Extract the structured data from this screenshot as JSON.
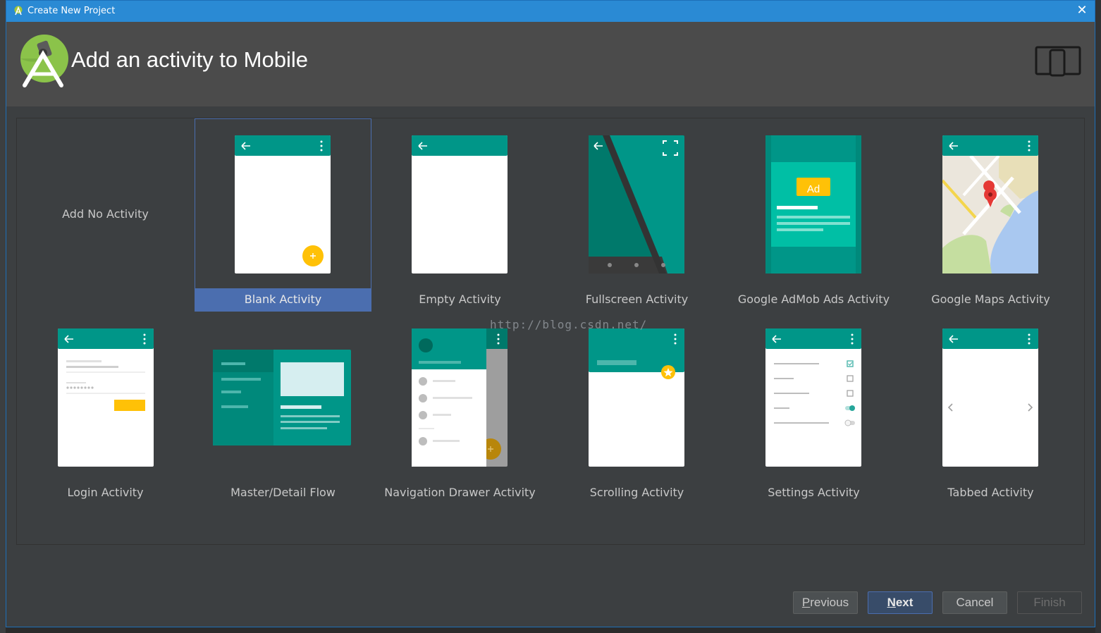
{
  "window": {
    "title": "Create New Project"
  },
  "header": {
    "heading": "Add an activity to Mobile"
  },
  "watermark": "http://blog.csdn.net/",
  "activities": [
    {
      "label": "Add No Activity"
    },
    {
      "label": "Blank Activity",
      "selected": true
    },
    {
      "label": "Empty Activity"
    },
    {
      "label": "Fullscreen Activity"
    },
    {
      "label": "Google AdMob Ads Activity",
      "ad_badge": "Ad"
    },
    {
      "label": "Google Maps Activity"
    },
    {
      "label": "Login Activity"
    },
    {
      "label": "Master/Detail Flow"
    },
    {
      "label": "Navigation Drawer Activity"
    },
    {
      "label": "Scrolling Activity"
    },
    {
      "label": "Settings Activity"
    },
    {
      "label": "Tabbed Activity"
    }
  ],
  "buttons": {
    "previous": {
      "mnemonic": "P",
      "rest": "revious"
    },
    "next": {
      "mnemonic": "N",
      "rest": "ext"
    },
    "cancel": "Cancel",
    "finish": "Finish"
  },
  "colors": {
    "teal": "#009688",
    "accent": "#ffc107",
    "selection": "#4b6eaf",
    "titlebar": "#2a8ad4"
  }
}
